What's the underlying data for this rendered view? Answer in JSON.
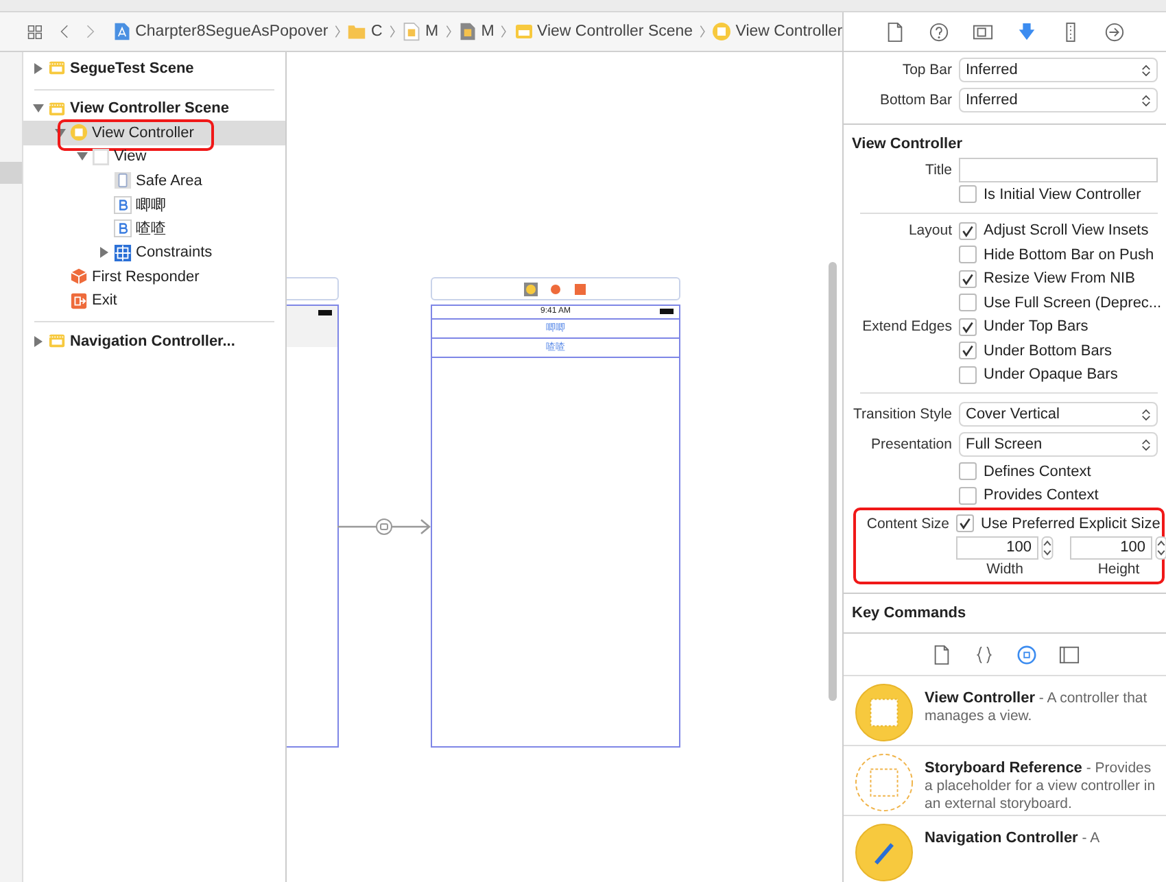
{
  "jump_bar": {
    "items": [
      {
        "kind": "project",
        "label": "Charpter8SegueAsPopover"
      },
      {
        "kind": "folder",
        "label": "C"
      },
      {
        "kind": "storyboard",
        "label": "M"
      },
      {
        "kind": "base",
        "label": "M"
      },
      {
        "kind": "scene",
        "label": "View Controller Scene"
      },
      {
        "kind": "controller",
        "label": "View Controller"
      }
    ]
  },
  "outline": {
    "items": [
      {
        "kind": "scene",
        "label": "SegueTest Scene",
        "expanded": false,
        "selected": false
      },
      {
        "kind": "scene",
        "label": "View Controller Scene",
        "expanded": true,
        "selected": false,
        "children": [
          {
            "kind": "controller",
            "label": "View Controller",
            "expanded": true,
            "selected": true,
            "highlighted": true,
            "children": [
              {
                "kind": "view",
                "label": "View",
                "expanded": true,
                "selected": false,
                "children": [
                  {
                    "kind": "safe-area",
                    "label": "Safe Area",
                    "selected": false
                  },
                  {
                    "kind": "button",
                    "label": "唧唧",
                    "selected": false
                  },
                  {
                    "kind": "button",
                    "label": "喳喳",
                    "selected": false
                  },
                  {
                    "kind": "constraints",
                    "label": "Constraints",
                    "expanded": false,
                    "selected": false
                  }
                ]
              }
            ]
          },
          {
            "kind": "responder",
            "label": "First Responder",
            "selected": false
          },
          {
            "kind": "exit",
            "label": "Exit",
            "selected": false
          }
        ]
      },
      {
        "kind": "scene",
        "label": "Navigation Controller...",
        "expanded": false,
        "selected": false
      }
    ]
  },
  "canvas": {
    "scene": {
      "time": "9:41 AM",
      "buttons": [
        "唧唧",
        "喳喳"
      ]
    }
  },
  "inspector": {
    "tabs": [
      {
        "kind": "file",
        "selected": false
      },
      {
        "kind": "help",
        "selected": false
      },
      {
        "kind": "identity",
        "selected": false
      },
      {
        "kind": "attributes",
        "selected": true
      },
      {
        "kind": "size",
        "selected": false
      },
      {
        "kind": "connections",
        "selected": false
      }
    ],
    "rows": [
      {
        "kind": "select",
        "label": "Top Bar",
        "value": "Inferred"
      },
      {
        "kind": "select",
        "label": "Bottom Bar",
        "value": "Inferred"
      },
      {
        "kind": "heading",
        "label": "View Controller"
      },
      {
        "kind": "text",
        "label": "Title"
      },
      {
        "kind": "check",
        "text": "Is Initial View Controller",
        "checked": false
      },
      {
        "kind": "divider"
      },
      {
        "kind": "check",
        "label": "Layout",
        "text": "Adjust Scroll View Insets",
        "checked": true
      },
      {
        "kind": "check",
        "text": "Hide Bottom Bar on Push",
        "checked": false
      },
      {
        "kind": "check",
        "text": "Resize View From NIB",
        "checked": true
      },
      {
        "kind": "check",
        "text": "Use Full Screen (Deprec...",
        "checked": false
      },
      {
        "kind": "check",
        "label": "Extend Edges",
        "text": "Under Top Bars",
        "checked": true
      },
      {
        "kind": "check",
        "text": "Under Bottom Bars",
        "checked": true
      },
      {
        "kind": "check",
        "text": "Under Opaque Bars",
        "checked": false
      },
      {
        "kind": "divider"
      },
      {
        "kind": "select",
        "label": "Transition Style",
        "value": "Cover Vertical"
      },
      {
        "kind": "select",
        "label": "Presentation",
        "value": "Full Screen"
      },
      {
        "kind": "check",
        "text": "Defines Context",
        "checked": false
      },
      {
        "kind": "check",
        "text": "Provides Context",
        "checked": false
      },
      {
        "kind": "group",
        "highlighted": true,
        "rows": [
          {
            "kind": "check",
            "label": "Content Size",
            "text": "Use Preferred Explicit Size",
            "checked": true
          },
          {
            "kind": "size",
            "fields": [
              {
                "value": "100",
                "caption": "Width"
              },
              {
                "value": "100",
                "caption": "Height"
              }
            ]
          }
        ]
      },
      {
        "kind": "heading",
        "label": "Key Commands"
      }
    ]
  },
  "library": {
    "tabs": [
      {
        "kind": "file",
        "selected": false
      },
      {
        "kind": "code",
        "selected": false
      },
      {
        "kind": "object",
        "selected": true
      },
      {
        "kind": "media",
        "selected": false
      }
    ],
    "items": [
      {
        "kind": "view-controller",
        "title": "View Controller",
        "description": " - A controller that manages a view."
      },
      {
        "kind": "storyboard-reference",
        "title": "Storyboard Reference",
        "description": " - Provides a placeholder for a view controller in an external storyboard."
      },
      {
        "kind": "navigation-controller",
        "title": "Navigation Controller",
        "description": " - A"
      }
    ]
  }
}
